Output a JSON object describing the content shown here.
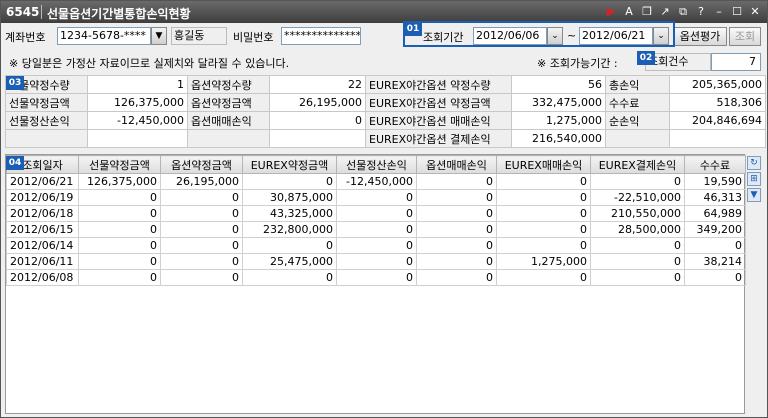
{
  "window": {
    "code": "6545",
    "title": "선물옵션기간별통합손익현황"
  },
  "account": {
    "label": "계좌번호",
    "value": "1234-5678-****",
    "owner": "홍길동",
    "password_label": "비밀번호",
    "password_value": "****************"
  },
  "period": {
    "label": "조회기간",
    "start": "2012/06/06",
    "tilde": "~",
    "end": "2012/06/21",
    "option_eval_button": "옵션평가",
    "search_button": "조회"
  },
  "badges": {
    "b1": "01",
    "b2": "02",
    "b3": "03",
    "b4": "04"
  },
  "notice": "※ 당일분은 가정산 자료이므로 실제치와 달라질 수 있습니다.",
  "avail": {
    "label": "※ 조회가능기간 :",
    "count_label": "조회건수",
    "count_value": "7"
  },
  "summary": {
    "r1": [
      "선물약정수량",
      "1",
      "옵션약정수량",
      "22",
      "EUREX야간옵션 약정수량",
      "56",
      "총손익",
      "205,365,000"
    ],
    "r2": [
      "선물약정금액",
      "126,375,000",
      "옵션약정금액",
      "26,195,000",
      "EUREX야간옵션 약정금액",
      "332,475,000",
      "수수료",
      "518,306"
    ],
    "r3": [
      "선물정산손익",
      "-12,450,000",
      "옵션매매손익",
      "0",
      "EUREX야간옵션 매매손익",
      "1,275,000",
      "순손익",
      "204,846,694"
    ],
    "r4": [
      "",
      "",
      "",
      "",
      "EUREX야간옵션 결제손익",
      "216,540,000",
      "",
      ""
    ]
  },
  "grid": {
    "headers": [
      "조회일자",
      "선물약정금액",
      "옵션약정금액",
      "EUREX약정금액",
      "선물정산손익",
      "옵션매매손익",
      "EUREX매매손익",
      "EUREX결제손익",
      "수수료"
    ],
    "rows": [
      [
        "2012/06/21",
        "126,375,000",
        "26,195,000",
        "0",
        "-12,450,000",
        "0",
        "0",
        "0",
        "19,590"
      ],
      [
        "2012/06/19",
        "0",
        "0",
        "30,875,000",
        "0",
        "0",
        "0",
        "-22,510,000",
        "46,313"
      ],
      [
        "2012/06/18",
        "0",
        "0",
        "43,325,000",
        "0",
        "0",
        "0",
        "210,550,000",
        "64,989"
      ],
      [
        "2012/06/15",
        "0",
        "0",
        "232,800,000",
        "0",
        "0",
        "0",
        "28,500,000",
        "349,200"
      ],
      [
        "2012/06/14",
        "0",
        "0",
        "0",
        "0",
        "0",
        "0",
        "0",
        "0"
      ],
      [
        "2012/06/11",
        "0",
        "0",
        "25,475,000",
        "0",
        "0",
        "1,275,000",
        "0",
        "38,214"
      ],
      [
        "2012/06/08",
        "0",
        "0",
        "0",
        "0",
        "0",
        "0",
        "0",
        "0"
      ]
    ]
  },
  "icons": {
    "titlebar": [
      "play-icon",
      "font-icon",
      "copy-icon",
      "popout-icon",
      "restore-icon",
      "help-icon",
      "minimize-icon",
      "maximize-icon",
      "close-icon"
    ],
    "side": [
      "refresh-icon",
      "export-icon",
      "scroll-down-icon"
    ]
  }
}
